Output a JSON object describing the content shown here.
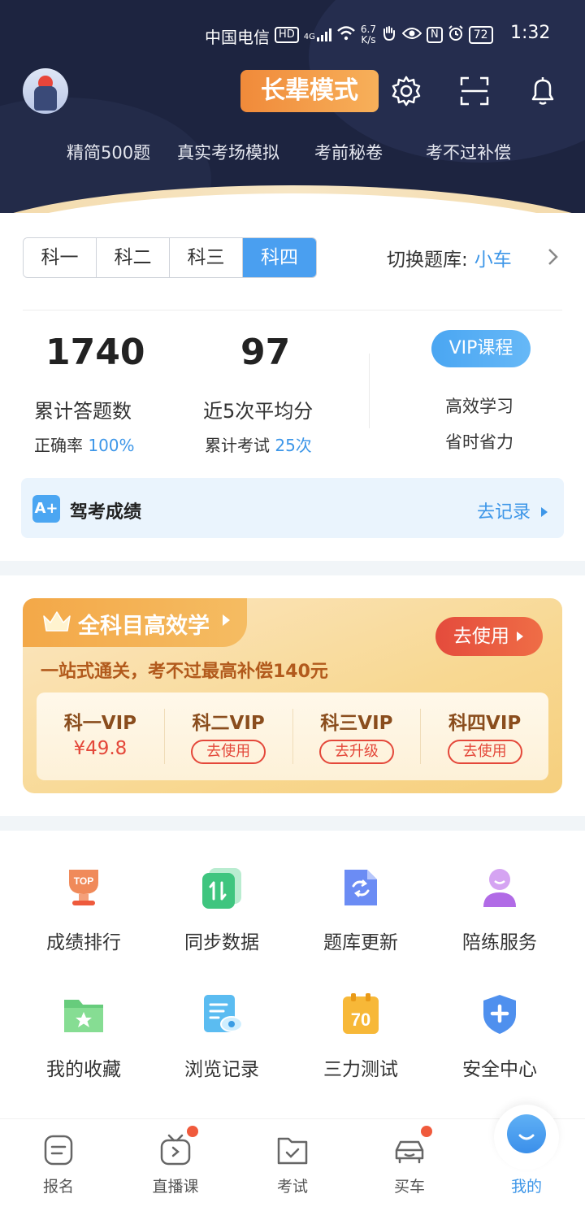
{
  "status_bar": {
    "carrier": "中国电信",
    "hd": "HD",
    "signal": "4G",
    "speed_value": "6.7",
    "speed_unit": "K/s",
    "nfc": "N",
    "battery": "72",
    "time": "1:32"
  },
  "header": {
    "elder_mode": "长辈模式",
    "tabs": [
      "精简500题",
      "真实考场模拟",
      "考前秘卷",
      "考不过补偿"
    ]
  },
  "subject_tabs": [
    "科一",
    "科二",
    "科三",
    "科四"
  ],
  "active_subject_index": 3,
  "question_bank": {
    "label": "切换题库:",
    "value": "小车"
  },
  "stats": {
    "total_answered": "1740",
    "total_answered_label": "累计答题数",
    "accuracy_label": "正确率",
    "accuracy_value": "100%",
    "avg_score": "97",
    "avg_score_label": "近5次平均分",
    "exams_label": "累计考试",
    "exams_value": "25次"
  },
  "vip_course": {
    "button": "VIP课程",
    "desc1": "高效学习",
    "desc2": "省时省力"
  },
  "score_record": {
    "icon_text": "A+",
    "title": "驾考成绩",
    "link": "去记录"
  },
  "vip_card": {
    "tag_title": "全科目高效学",
    "use_button": "去使用",
    "slogan": "一站式通关，考不过最高补偿140元",
    "items": [
      {
        "title": "科一VIP",
        "price": "¥49.8"
      },
      {
        "title": "科二VIP",
        "button": "去使用"
      },
      {
        "title": "科三VIP",
        "button": "去升级"
      },
      {
        "title": "科四VIP",
        "button": "去使用"
      }
    ]
  },
  "services": [
    {
      "label": "成绩排行",
      "icon": "trophy-icon",
      "badge": "TOP"
    },
    {
      "label": "同步数据",
      "icon": "sync-icon"
    },
    {
      "label": "题库更新",
      "icon": "refresh-icon"
    },
    {
      "label": "陪练服务",
      "icon": "coach-icon"
    },
    {
      "label": "我的收藏",
      "icon": "favorites-folder-icon"
    },
    {
      "label": "浏览记录",
      "icon": "history-icon"
    },
    {
      "label": "三力测试",
      "icon": "test-icon",
      "badge": "70"
    },
    {
      "label": "安全中心",
      "icon": "shield-icon"
    }
  ],
  "bottom_nav": [
    {
      "label": "报名",
      "icon": "register-icon"
    },
    {
      "label": "直播课",
      "icon": "live-icon",
      "dot": true
    },
    {
      "label": "考试",
      "icon": "exam-icon"
    },
    {
      "label": "买车",
      "icon": "car-icon",
      "dot": true
    },
    {
      "label": "我的",
      "icon": "mine-icon",
      "active": true
    }
  ],
  "colors": {
    "accent_blue": "#3d96e8",
    "header_dark": "#1d2440",
    "vip_orange": "#f3a848",
    "vip_red": "#e4483a"
  }
}
